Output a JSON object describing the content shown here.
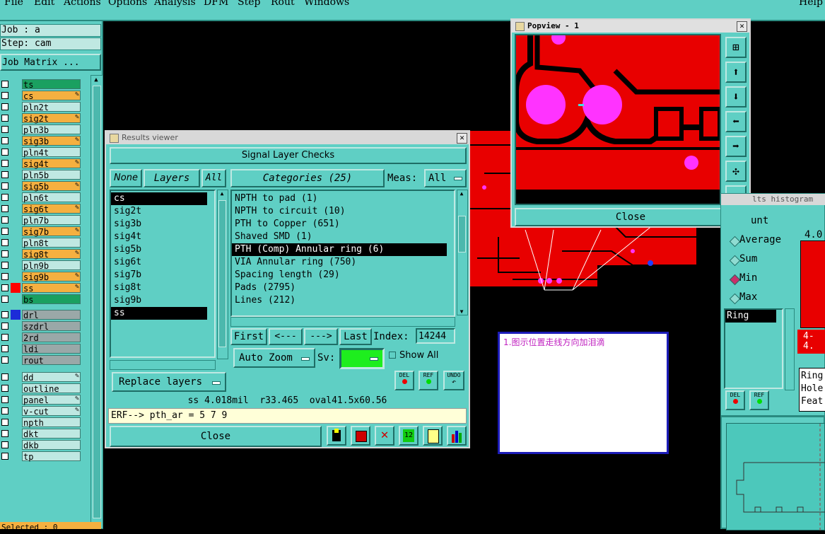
{
  "menubar": {
    "items": [
      "File",
      "Edit",
      "Actions",
      "Options",
      "Analysis",
      "DFM",
      "Step",
      "Rout",
      "Windows"
    ],
    "help": "Help"
  },
  "left_panel": {
    "job": "Job : a",
    "step": "Step: cam",
    "job_matrix": "Job Matrix ...",
    "layers": [
      {
        "name": "ts",
        "color": "#1aa060",
        "editable": false
      },
      {
        "name": "cs",
        "color": "#f5b040",
        "editable": true
      },
      {
        "name": "pln2t",
        "color": "#bfe8e2",
        "editable": false
      },
      {
        "name": "sig2t",
        "color": "#f5b040",
        "editable": true
      },
      {
        "name": "pln3b",
        "color": "#bfe8e2",
        "editable": false
      },
      {
        "name": "sig3b",
        "color": "#f5b040",
        "editable": true
      },
      {
        "name": "pln4t",
        "color": "#bfe8e2",
        "editable": false
      },
      {
        "name": "sig4t",
        "color": "#f5b040",
        "editable": true
      },
      {
        "name": "pln5b",
        "color": "#bfe8e2",
        "editable": false
      },
      {
        "name": "sig5b",
        "color": "#f5b040",
        "editable": true
      },
      {
        "name": "pln6t",
        "color": "#bfe8e2",
        "editable": false
      },
      {
        "name": "sig6t",
        "color": "#f5b040",
        "editable": true
      },
      {
        "name": "pln7b",
        "color": "#bfe8e2",
        "editable": false
      },
      {
        "name": "sig7b",
        "color": "#f5b040",
        "editable": true
      },
      {
        "name": "pln8t",
        "color": "#bfe8e2",
        "editable": false
      },
      {
        "name": "sig8t",
        "color": "#f5b040",
        "editable": true
      },
      {
        "name": "pln9b",
        "color": "#bfe8e2",
        "editable": false
      },
      {
        "name": "sig9b",
        "color": "#f5b040",
        "editable": true
      },
      {
        "name": "ss",
        "color": "#f5b040",
        "editable": true,
        "swatch": "#ff0000"
      },
      {
        "name": "bs",
        "color": "#1aa060",
        "editable": false
      },
      {
        "name": "drl",
        "color": "#9aa8a8",
        "editable": false,
        "swatch": "#1c2cd8"
      },
      {
        "name": "szdrl",
        "color": "#9aa8a8",
        "editable": false
      },
      {
        "name": "2rd",
        "color": "#9aa8a8",
        "editable": false
      },
      {
        "name": "ldi",
        "color": "#9aa8a8",
        "editable": false
      },
      {
        "name": "rout",
        "color": "#9aa8a8",
        "editable": false
      },
      {
        "name": "dd",
        "color": "#bfe8e2",
        "editable": true
      },
      {
        "name": "outline",
        "color": "#bfe8e2",
        "editable": false
      },
      {
        "name": "panel",
        "color": "#bfe8e2",
        "editable": true
      },
      {
        "name": "v-cut",
        "color": "#bfe8e2",
        "editable": true
      },
      {
        "name": "npth",
        "color": "#bfe8e2",
        "editable": false
      },
      {
        "name": "dkt",
        "color": "#bfe8e2",
        "editable": false
      },
      {
        "name": "dkb",
        "color": "#bfe8e2",
        "editable": false
      },
      {
        "name": "tp",
        "color": "#bfe8e2",
        "editable": false
      }
    ],
    "selected_count": "Selected : 0"
  },
  "results_viewer": {
    "title": "Results viewer",
    "header": "Signal Layer Checks",
    "none_btn": "None",
    "layers_btn": "Layers",
    "all_btn": "All",
    "layer_list": [
      "cs",
      "sig2t",
      "sig3b",
      "sig4t",
      "sig5b",
      "sig6t",
      "sig7b",
      "sig8t",
      "sig9b",
      "ss"
    ],
    "layer_selected": [
      "cs",
      "ss"
    ],
    "categories_btn": "Categories (25)",
    "meas_label": "Meas:",
    "meas_value": "All",
    "category_list": [
      "NPTH to pad (1)",
      "NPTH to circuit (10)",
      "PTH to Copper (651)",
      "Shaved SMD (1)",
      "PTH (Comp) Annular ring (6)",
      "VIA Annular ring (750)",
      "Spacing length (29)",
      "Pads (2795)",
      "Lines (212)"
    ],
    "category_selected": "PTH (Comp) Annular ring (6)",
    "first_btn": "First",
    "prev_btn": "<---",
    "next_btn": "--->",
    "last_btn": "Last",
    "index_label": "Index:",
    "index_value": "14244",
    "auto_zoom": "Auto Zoom",
    "sv_label": "Sv:",
    "show_all": "Show All",
    "replace_layers": "Replace layers",
    "del_label": "DEL",
    "ref_label": "REF",
    "undo_label": "UNDO",
    "status_line": "ss 4.018mil  r33.465  oval41.5x60.56",
    "erf_line": "ERF--> pth_ar = 5 7 9",
    "close": "Close",
    "icon_12": "12"
  },
  "popview": {
    "title": "Popview - 1",
    "close": "Close"
  },
  "note": {
    "text": "1.图示位置走线方向加泪滴",
    "color": "#c020c0"
  },
  "histogram": {
    "title": "lts histogram",
    "count_label": "unt",
    "radios": [
      "Average",
      "Sum",
      "Min",
      "Max"
    ],
    "selected_radio": "Min",
    "list_item": "Ring",
    "bar_value_label": "4.0",
    "range_label": "4-\n4.",
    "del_label": "DEL",
    "ref_label": "REF",
    "info_lines": [
      "Ring",
      "Hole",
      "Feat"
    ]
  },
  "colors": {
    "teal": "#5fcfc4",
    "light_teal": "#bfe8e2",
    "dark_teal": "#1e6e66",
    "pcb_red": "#e80000",
    "magenta": "#ff33ff",
    "orange": "#f5b040",
    "green_layer": "#1aa060"
  }
}
